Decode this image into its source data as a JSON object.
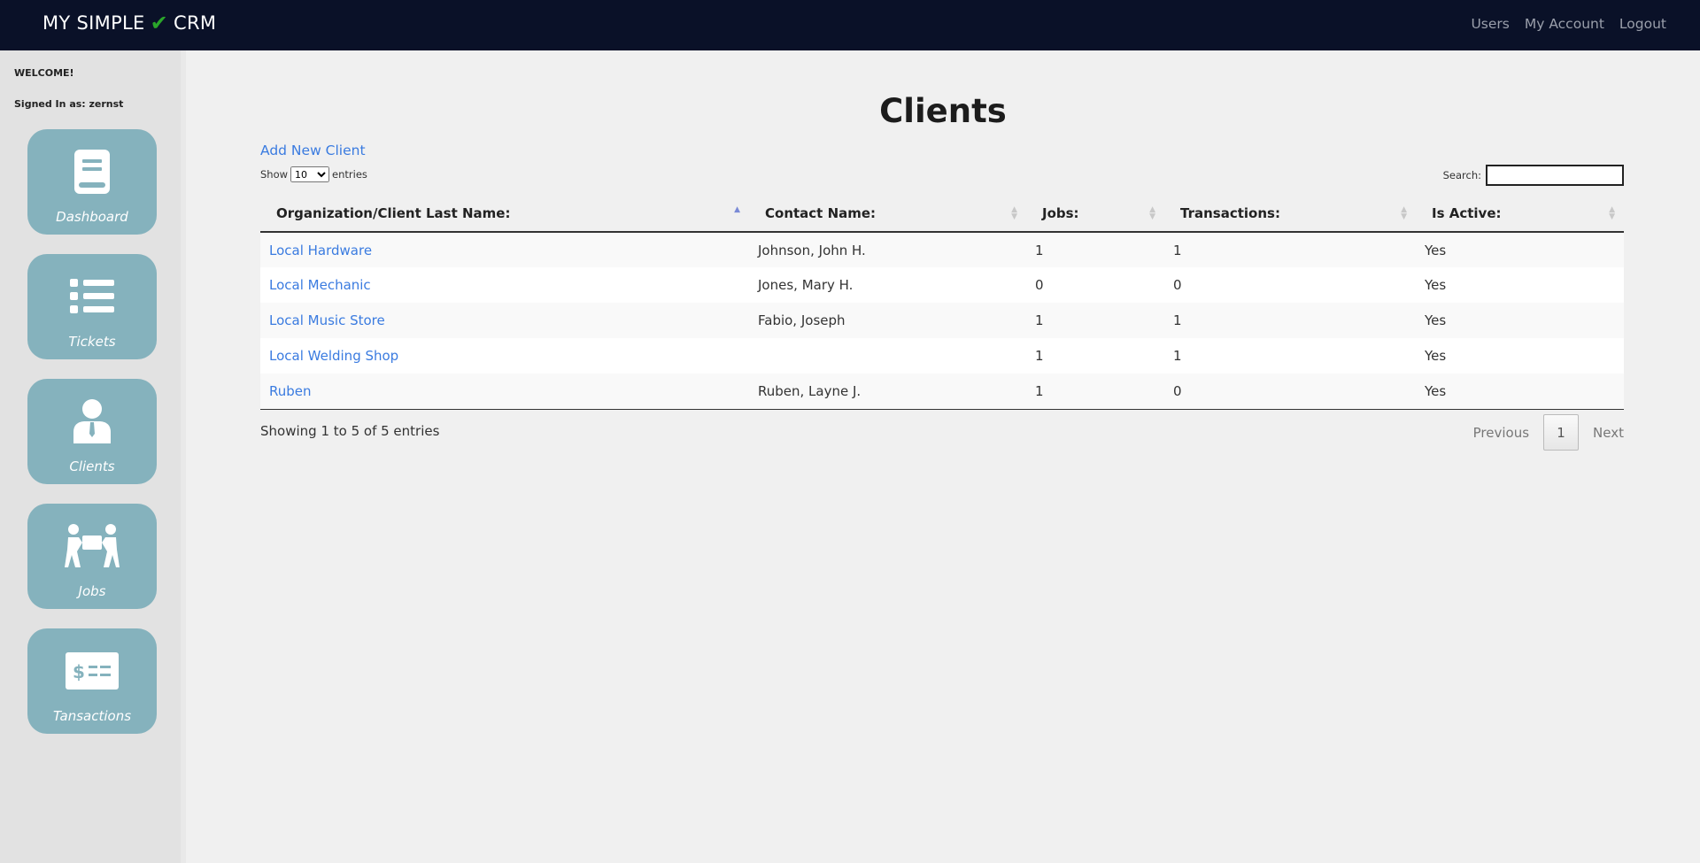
{
  "brand": {
    "left": "MY SIMPLE",
    "right": "CRM"
  },
  "topnav": {
    "users": "Users",
    "account": "My Account",
    "logout": "Logout"
  },
  "sidebar": {
    "welcome": "WELCOME!",
    "signed_in": "Signed In as: zernst",
    "tiles": [
      {
        "label": "Dashboard",
        "icon": "book-icon"
      },
      {
        "label": "Tickets",
        "icon": "list-icon"
      },
      {
        "label": "Clients",
        "icon": "person-icon"
      },
      {
        "label": "Jobs",
        "icon": "workers-icon"
      },
      {
        "label": "Tansactions",
        "icon": "check-icon"
      }
    ]
  },
  "main": {
    "title": "Clients",
    "add_link": "Add New Client",
    "show_label": "Show",
    "entries_label": "entries",
    "page_size": "10",
    "search_label": "Search:",
    "columns": [
      "Organization/Client Last Name:",
      "Contact Name:",
      "Jobs:",
      "Transactions:",
      "Is Active:"
    ],
    "rows": [
      {
        "org": "Local Hardware",
        "contact": "Johnson, John H.",
        "jobs": "1",
        "transactions": "1",
        "active": "Yes"
      },
      {
        "org": "Local Mechanic",
        "contact": "Jones, Mary H.",
        "jobs": "0",
        "transactions": "0",
        "active": "Yes"
      },
      {
        "org": "Local Music Store",
        "contact": "Fabio, Joseph",
        "jobs": "1",
        "transactions": "1",
        "active": "Yes"
      },
      {
        "org": "Local Welding Shop",
        "contact": "",
        "jobs": "1",
        "transactions": "1",
        "active": "Yes"
      },
      {
        "org": "Ruben",
        "contact": "Ruben, Layne J.",
        "jobs": "1",
        "transactions": "0",
        "active": "Yes"
      }
    ],
    "info": "Showing 1 to 5 of 5 entries",
    "pager": {
      "previous": "Previous",
      "current": "1",
      "next": "Next"
    }
  },
  "colors": {
    "navbar": "#0a1128",
    "tile": "#85b2bd",
    "link": "#3a7be0",
    "check": "#2aa52a"
  }
}
